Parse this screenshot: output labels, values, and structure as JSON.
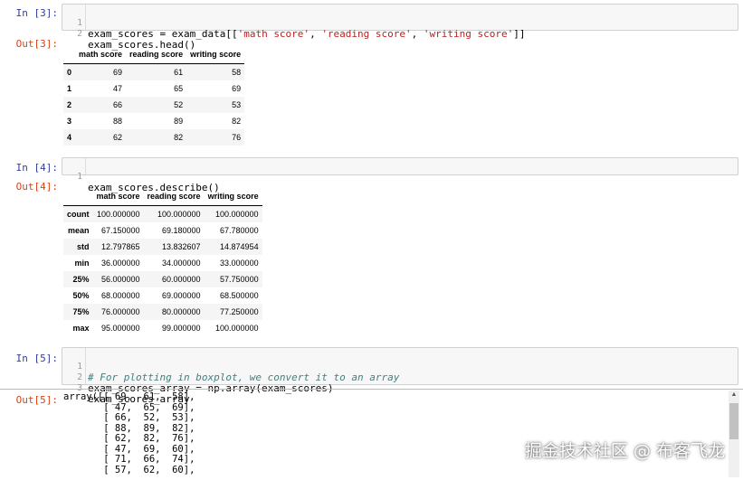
{
  "cells": [
    {
      "in_prompt": "In [3]:",
      "out_prompt": "Out[3]:",
      "code_lines": [
        {
          "n": "1",
          "text": "exam_scores = exam_data[['math score', 'reading score', 'writing score']]"
        },
        {
          "n": "2",
          "text": "exam_scores.head()"
        }
      ]
    },
    {
      "in_prompt": "In [4]:",
      "out_prompt": "Out[4]:",
      "code_lines": [
        {
          "n": "1",
          "text": "exam_scores.describe()"
        }
      ]
    },
    {
      "in_prompt": "In [5]:",
      "out_prompt": "Out[5]:",
      "code_lines": [
        {
          "n": "1",
          "text": "# For plotting in boxplot, we convert it to an array"
        },
        {
          "n": "2",
          "text": "exam_scores_array = np.array(exam_scores)"
        },
        {
          "n": "3",
          "text": "exam_scores_array"
        }
      ]
    }
  ],
  "head_table": {
    "columns": [
      "",
      "math score",
      "reading score",
      "writing score"
    ],
    "rows": [
      [
        "0",
        "69",
        "61",
        "58"
      ],
      [
        "1",
        "47",
        "65",
        "69"
      ],
      [
        "2",
        "66",
        "52",
        "53"
      ],
      [
        "3",
        "88",
        "89",
        "82"
      ],
      [
        "4",
        "62",
        "82",
        "76"
      ]
    ]
  },
  "describe_table": {
    "columns": [
      "",
      "math score",
      "reading score",
      "writing score"
    ],
    "rows": [
      [
        "count",
        "100.000000",
        "100.000000",
        "100.000000"
      ],
      [
        "mean",
        "67.150000",
        "69.180000",
        "67.780000"
      ],
      [
        "std",
        "12.797865",
        "13.832607",
        "14.874954"
      ],
      [
        "min",
        "36.000000",
        "34.000000",
        "33.000000"
      ],
      [
        "25%",
        "56.000000",
        "60.000000",
        "57.750000"
      ],
      [
        "50%",
        "68.000000",
        "69.000000",
        "68.500000"
      ],
      [
        "75%",
        "76.000000",
        "80.000000",
        "77.250000"
      ],
      [
        "max",
        "95.000000",
        "99.000000",
        "100.000000"
      ]
    ]
  },
  "array_output": "array([[ 69,  61,  58],\n       [ 47,  65,  69],\n       [ 66,  52,  53],\n       [ 88,  89,  82],\n       [ 62,  82,  76],\n       [ 47,  69,  60],\n       [ 71,  66,  74],\n       [ 57,  62,  60],",
  "watermark": "掘金技术社区 @ 布客飞龙",
  "colors": {
    "in_prompt": "#303f9f",
    "out_prompt": "#d84315",
    "string": "#ba2121",
    "comment": "#408080"
  }
}
